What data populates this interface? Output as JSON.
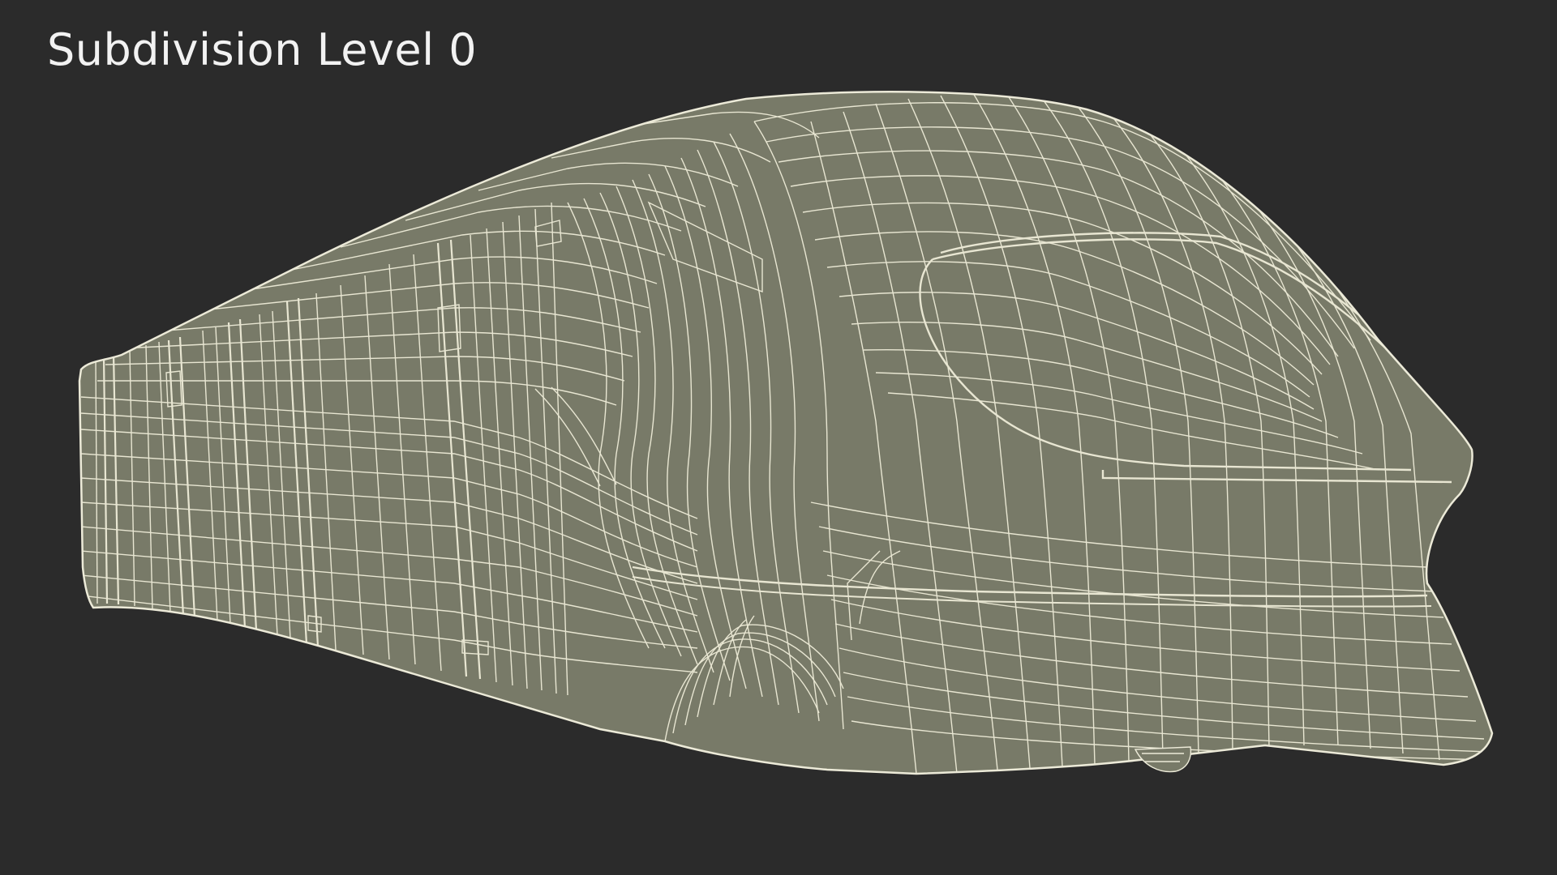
{
  "title": "Subdivision Level 0",
  "colors": {
    "background": "#2b2b2b",
    "surface": "#787a68",
    "wire": "#ecead8",
    "title_text": "#f2f2f2"
  }
}
